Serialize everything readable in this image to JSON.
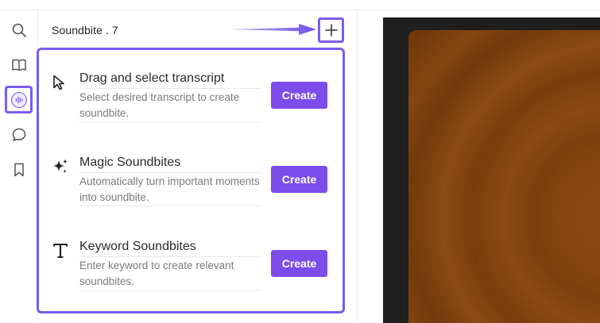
{
  "panel": {
    "title": "Soundbite . 7"
  },
  "options": [
    {
      "title": "Drag and select transcript",
      "description": "Select desired transcript to create soundbite.",
      "button": "Create",
      "icon": "cursor-arrow-icon"
    },
    {
      "title": "Magic Soundbites",
      "description": "Automatically turn important moments into soundbite.",
      "button": "Create",
      "icon": "sparkles-icon"
    },
    {
      "title": "Keyword Soundbites",
      "description": "Enter keyword to create relevant soundbites.",
      "button": "Create",
      "icon": "text-T-icon"
    }
  ],
  "rail": [
    "search-icon",
    "book-icon",
    "soundbite-icon",
    "comment-icon",
    "bookmark-icon"
  ],
  "colors": {
    "accent": "#7b5cf0",
    "button": "#7c4dea",
    "video_background": "#1f1f1f"
  }
}
